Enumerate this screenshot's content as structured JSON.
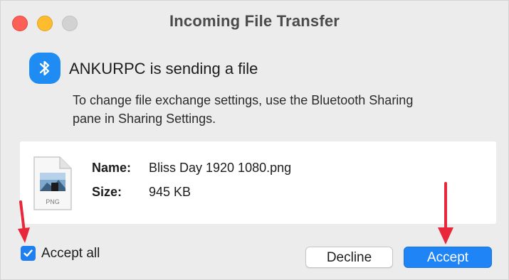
{
  "window": {
    "title": "Incoming File Transfer"
  },
  "message": {
    "heading": "ANKURPC is sending a file",
    "description_line1": "To change file exchange settings, use the Bluetooth Sharing",
    "description_line2": "pane in Sharing Settings."
  },
  "file": {
    "name_label": "Name:",
    "name_value": "Bliss Day 1920 1080.png",
    "size_label": "Size:",
    "size_value": "945 KB",
    "type_badge": "PNG"
  },
  "accept_all": {
    "label": "Accept all",
    "checked": true
  },
  "buttons": {
    "decline": "Decline",
    "accept": "Accept"
  },
  "colors": {
    "accent": "#1f84f5",
    "annotation_arrow": "#e8283a",
    "close": "#fe5f57",
    "minimize": "#febc2e",
    "zoom": "#d2d2d2"
  }
}
